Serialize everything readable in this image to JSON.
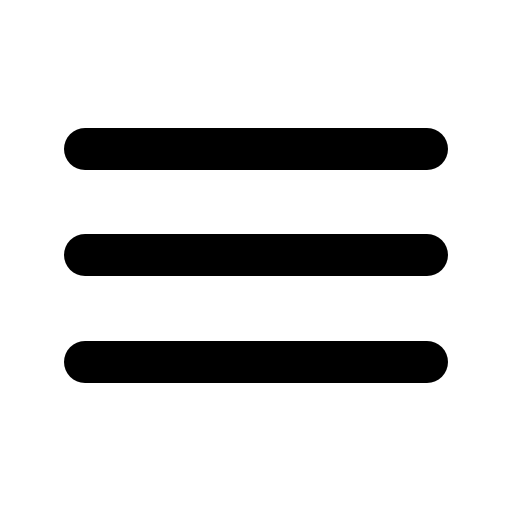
{
  "icon": {
    "name": "hamburger-menu-icon",
    "line_count": 3,
    "color": "#000000",
    "background": "#ffffff"
  }
}
